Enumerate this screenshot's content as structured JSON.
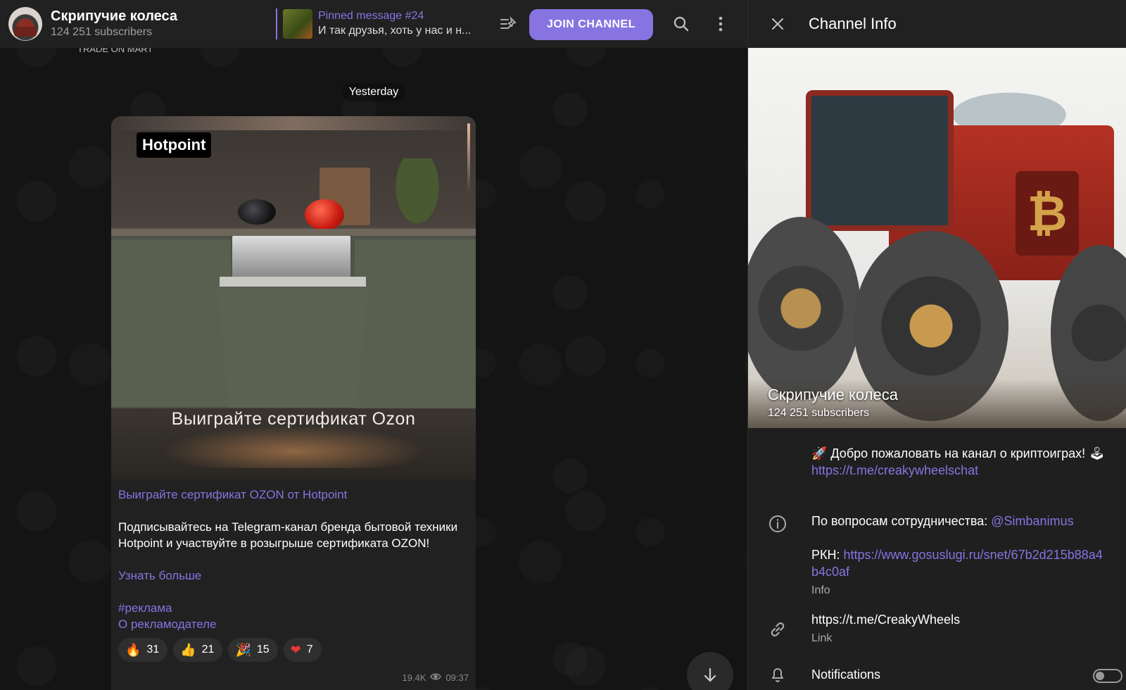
{
  "chat": {
    "header": {
      "title": "Скрипучие колеса",
      "subscribers": "124 251 subscribers",
      "pinned": {
        "title": "Pinned message #24",
        "preview": "И так друзья, хоть у нас и н..."
      },
      "join_label": "JOIN CHANNEL"
    },
    "top_peek": "TRADE ON MART",
    "date": "Yesterday",
    "message": {
      "ad_logo": "Hotpoint",
      "ad_caption": "Выиграйте сертификат Ozon",
      "title_link": "Выиграйте сертификат OZON от Hotpoint",
      "paragraph": "Подписывайтесь на Telegram-канал бренда бытовой техники Hotpoint и участвуйте в розыгрыше сертификата OZON!",
      "learn_more": "Узнать больше",
      "hashtag": "#реклама",
      "advertiser": "О рекламодателе",
      "reactions": [
        {
          "emoji": "🔥",
          "count": "31"
        },
        {
          "emoji": "👍",
          "count": "21"
        },
        {
          "emoji": "🎉",
          "count": "15"
        },
        {
          "emoji": "❤",
          "count": "7"
        }
      ],
      "views": "19.4K",
      "time": "09:37"
    }
  },
  "info": {
    "title": "Channel Info",
    "cover_name": "Скрипучие колеса",
    "cover_subs": "124 251 subscribers",
    "tractor_badge": "₿",
    "description_line1": "🚀 Добро пожаловать на канал о криптоиграх! 🕹",
    "description_link": "https://t.me/creakywheelschat",
    "coop_label": "По вопросам сотрудничества: ",
    "coop_handle": "@Simbanimus",
    "rkn_label": "РКН: ",
    "rkn_link": "https://www.gosuslugi.ru/snet/67b2d215b88a4b4c0af",
    "info_sub": "Info",
    "link_value": "https://t.me/CreakyWheels",
    "link_sub": "Link",
    "notifications_label": "Notifications"
  },
  "colors": {
    "accent": "#8774e1",
    "panel": "#212121"
  }
}
